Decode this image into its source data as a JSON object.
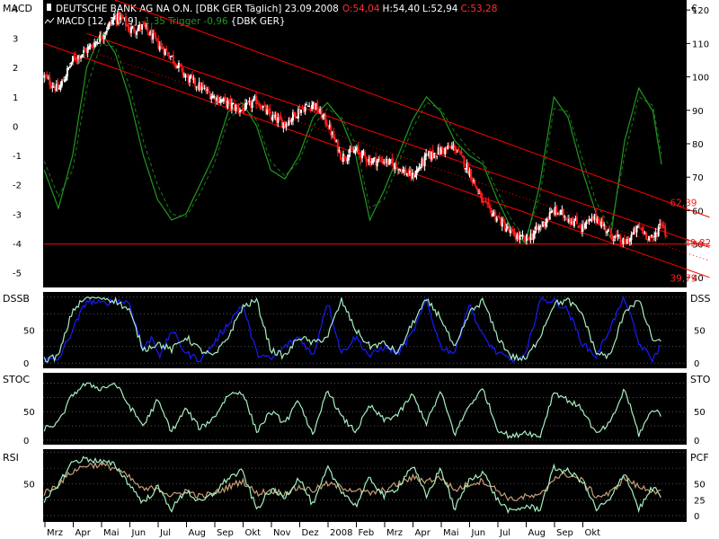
{
  "chart_data": [
    {
      "type": "line",
      "panel": "MACD",
      "title": "DEUTSCHE BANK AG NA O.N. [DBK GER  Täglich] 23.09.2008",
      "ohlc": {
        "open_label": "O:54,04",
        "high_label": "H:54,40",
        "low_label": "L:52,94",
        "close_label": "C:53,28"
      },
      "subtitle": "MACD [12, 26, 9]",
      "macd_value_label": "-1,35",
      "trigger_label": "Trigger -0,96",
      "subtitle_suffix": "{DBK GER}",
      "left_label": "MACD",
      "right_label": "€",
      "left_ticks": [
        "4",
        "3",
        "2",
        "1",
        "0",
        "-1",
        "-2",
        "-3",
        "-4",
        "-5"
      ],
      "right_ticks": [
        "120",
        "110",
        "100",
        "90",
        "80",
        "70",
        "60",
        "50",
        "40"
      ],
      "ylim_left": [
        -5.5,
        4.3
      ],
      "ylim_right": [
        37,
        123
      ],
      "x_month_positions": [
        0,
        1,
        2,
        3,
        4,
        5,
        6,
        7,
        8,
        9,
        10,
        11,
        12,
        13,
        14,
        15,
        16,
        17,
        18,
        19,
        20,
        21,
        22
      ],
      "price_knots": {
        "x": [
          -0.5,
          0,
          0.5,
          1,
          1.5,
          2,
          2.3,
          2.5,
          3,
          3.5,
          4,
          4.5,
          5,
          5.5,
          6,
          6.5,
          7,
          7.5,
          8,
          8.5,
          9,
          9.5,
          10,
          10.5,
          11,
          11.5,
          12,
          12.5,
          13,
          13.5,
          14,
          14.5,
          15,
          15.5,
          16,
          16.5,
          17,
          17.5,
          18,
          18.5,
          19,
          19.5,
          20,
          20.5,
          21,
          21.3,
          21.5
        ],
        "y": [
          100,
          96,
          105,
          108,
          112,
          118,
          117,
          114,
          115,
          110,
          106,
          100,
          97,
          94,
          92,
          90,
          93,
          88,
          86,
          90,
          92,
          86,
          76,
          78,
          75,
          75,
          73,
          70,
          76,
          78,
          79,
          72,
          62,
          58,
          53,
          51,
          55,
          60,
          58,
          55,
          58,
          53,
          50,
          55,
          51,
          57,
          52
        ]
      },
      "macd_knots": {
        "x": [
          -0.5,
          0,
          0.5,
          1,
          1.5,
          2,
          2.5,
          3,
          3.5,
          4,
          4.5,
          5,
          5.5,
          6,
          6.5,
          7,
          7.5,
          8,
          8.5,
          9,
          9.5,
          10,
          10.5,
          11,
          11.5,
          12,
          12.5,
          13,
          13.5,
          14,
          14.5,
          15,
          15.5,
          16,
          16.5,
          17,
          17.5,
          18,
          18.5,
          19,
          19.5,
          20,
          20.5,
          21,
          21.3
        ],
        "y": [
          -1.5,
          -2.8,
          -1,
          2,
          3.2,
          2.5,
          1,
          -1,
          -2.5,
          -3.2,
          -3,
          -2,
          -1,
          0.5,
          0.8,
          0,
          -1.5,
          -1.8,
          -1,
          0.3,
          0.8,
          0.2,
          -1,
          -3.2,
          -2.2,
          -1,
          0.2,
          1,
          0.5,
          -0.5,
          -1,
          -1.3,
          -2.5,
          -3.5,
          -4,
          -2,
          1,
          0.3,
          -1.5,
          -3,
          -3.8,
          -0.5,
          1.3,
          0.5,
          -1.3
        ]
      },
      "trigger_knots": {
        "x": [
          -0.5,
          0,
          0.5,
          1,
          1.5,
          2,
          2.5,
          3,
          3.5,
          4,
          4.5,
          5,
          5.5,
          6,
          6.5,
          7,
          7.5,
          8,
          8.5,
          9,
          9.5,
          10,
          10.5,
          11,
          11.5,
          12,
          12.5,
          13,
          13.5,
          14,
          14.5,
          15,
          15.5,
          16,
          16.5,
          17,
          17.5,
          18,
          18.5,
          19,
          19.5,
          20,
          20.5,
          21,
          21.3
        ],
        "y": [
          -1.2,
          -2.4,
          -1.5,
          1.3,
          2.8,
          2.7,
          1.4,
          -0.5,
          -2,
          -3,
          -3.1,
          -2.3,
          -1.3,
          0.2,
          0.7,
          0.2,
          -1.2,
          -1.7,
          -1.2,
          0,
          0.6,
          0.3,
          -0.6,
          -2.8,
          -2.5,
          -1.3,
          -0.1,
          0.8,
          0.6,
          -0.2,
          -0.8,
          -1.2,
          -2.2,
          -3.2,
          -3.8,
          -2.4,
          0.6,
          0.5,
          -1.1,
          -2.6,
          -3.5,
          -1,
          1,
          0.7,
          -0.96
        ]
      },
      "trendlines": [
        {
          "from": [
            2,
            123
          ],
          "to": [
            23,
            58
          ]
        },
        {
          "from": [
            -0.5,
            110
          ],
          "to": [
            23,
            40
          ]
        },
        {
          "from": [
            1,
            113
          ],
          "to": [
            23,
            49
          ]
        },
        {
          "from": [
            -0.5,
            50
          ],
          "to": [
            23,
            50
          ]
        }
      ],
      "annotations": [
        {
          "text": "62,39",
          "x": 21.6,
          "y": 62.4
        },
        {
          "text": "49,82",
          "x": 22.1,
          "y": 50.5
        },
        {
          "text": "39,79",
          "x": 21.6,
          "y": 39.8
        }
      ],
      "colors": {
        "up": "#ffffff",
        "down": "#ff1a1a",
        "macd": "#1f9a1f",
        "trigger": "#1a7a1a",
        "trend": "#ff0000"
      }
    },
    {
      "type": "line",
      "panel": "DSSB",
      "left_label": "DSSB",
      "right_label": "DSS",
      "left_ticks": [
        "50",
        "0"
      ],
      "right_ticks": [
        "50",
        "0"
      ],
      "ylim": [
        -8,
        108
      ],
      "series": [
        {
          "color": "#1a1aff",
          "x": [
            -0.5,
            0,
            0.5,
            1,
            1.5,
            2,
            2.5,
            3,
            3.3,
            3.6,
            4,
            4.5,
            5,
            5.5,
            6,
            6.5,
            7,
            7.5,
            8,
            8.5,
            9,
            9.5,
            10,
            10.5,
            11,
            11.5,
            12,
            12.5,
            13,
            13.5,
            14,
            14.5,
            15,
            15.5,
            16,
            16.5,
            17,
            17.5,
            18,
            18.5,
            19,
            19.5,
            20,
            20.5,
            21,
            21.3
          ],
          "y": [
            5,
            5,
            50,
            95,
            90,
            95,
            92,
            20,
            40,
            10,
            50,
            15,
            5,
            30,
            60,
            90,
            15,
            5,
            25,
            40,
            10,
            95,
            15,
            40,
            10,
            25,
            15,
            45,
            95,
            25,
            15,
            90,
            40,
            15,
            5,
            10,
            95,
            95,
            80,
            30,
            10,
            55,
            100,
            30,
            5,
            30
          ]
        },
        {
          "color": "#a6f0c0",
          "x": [
            -0.5,
            0,
            0.5,
            1,
            1.5,
            2,
            2.5,
            3,
            3.5,
            4,
            4.5,
            5,
            5.5,
            6,
            6.5,
            7,
            7.5,
            8,
            8.5,
            9,
            9.5,
            10,
            10.5,
            11,
            11.5,
            12,
            12.5,
            13,
            13.5,
            14,
            14.5,
            15,
            15.5,
            16,
            16.5,
            17,
            17.5,
            18,
            18.5,
            19,
            19.5,
            20,
            20.5,
            21,
            21.3
          ],
          "y": [
            5,
            10,
            80,
            100,
            100,
            95,
            80,
            20,
            30,
            20,
            40,
            20,
            10,
            40,
            85,
            95,
            20,
            10,
            40,
            30,
            40,
            95,
            50,
            25,
            30,
            15,
            60,
            95,
            70,
            20,
            75,
            95,
            40,
            10,
            5,
            40,
            90,
            95,
            75,
            15,
            10,
            80,
            95,
            35,
            30
          ]
        }
      ]
    },
    {
      "type": "line",
      "panel": "STOC",
      "left_label": "STOC",
      "right_label": "STO",
      "left_ticks": [
        "50",
        "0"
      ],
      "right_ticks": [
        "50",
        "0"
      ],
      "ylim": [
        -8,
        118
      ],
      "series": [
        {
          "color": "#a6f0c0",
          "x": [
            -0.5,
            0,
            0.5,
            1,
            1.5,
            2,
            2.5,
            3,
            3.5,
            4,
            4.5,
            5,
            5.5,
            6,
            6.5,
            7,
            7.5,
            8,
            8.5,
            9,
            9.5,
            10,
            10.5,
            11,
            11.5,
            12,
            12.5,
            13,
            13.5,
            14,
            14.5,
            15,
            15.5,
            16,
            16.5,
            17,
            17.5,
            18,
            18.5,
            19,
            19.5,
            20,
            20.5,
            21,
            21.3
          ],
          "y": [
            20,
            30,
            80,
            100,
            90,
            100,
            60,
            25,
            70,
            15,
            55,
            20,
            40,
            80,
            85,
            15,
            50,
            30,
            70,
            5,
            90,
            40,
            15,
            60,
            35,
            45,
            80,
            30,
            85,
            10,
            60,
            90,
            20,
            5,
            15,
            5,
            85,
            70,
            55,
            10,
            30,
            90,
            10,
            55,
            45
          ]
        }
      ]
    },
    {
      "type": "line",
      "panel": "RSI",
      "left_label": "RSI",
      "right_label": "PCF",
      "left_ticks": [
        "50"
      ],
      "right_ticks": [
        "50",
        "25",
        "0"
      ],
      "ylim": [
        -10,
        105
      ],
      "series": [
        {
          "color": "#c8a078",
          "x": [
            -0.5,
            0,
            0.5,
            1,
            1.5,
            2,
            2.5,
            3,
            3.5,
            4,
            4.5,
            5,
            5.5,
            6,
            6.5,
            7,
            7.5,
            8,
            8.5,
            9,
            9.5,
            10,
            10.5,
            11,
            11.5,
            12,
            12.5,
            13,
            13.5,
            14,
            14.5,
            15,
            15.5,
            16,
            16.5,
            17,
            17.5,
            18,
            18.5,
            19,
            19.5,
            20,
            20.5,
            21,
            21.3
          ],
          "y": [
            35,
            50,
            70,
            80,
            80,
            75,
            60,
            40,
            45,
            30,
            40,
            30,
            35,
            45,
            55,
            35,
            40,
            35,
            45,
            40,
            50,
            45,
            40,
            35,
            40,
            50,
            60,
            55,
            60,
            40,
            50,
            55,
            40,
            25,
            30,
            30,
            60,
            65,
            55,
            30,
            35,
            60,
            45,
            40,
            35
          ]
        },
        {
          "color": "#a6f0c0",
          "x": [
            -0.5,
            0,
            0.5,
            1,
            1.5,
            2,
            2.5,
            3,
            3.5,
            4,
            4.5,
            5,
            5.5,
            6,
            6.5,
            7,
            7.5,
            8,
            8.5,
            9,
            9.5,
            10,
            10.5,
            11,
            11.5,
            12,
            12.5,
            13,
            13.5,
            14,
            14.5,
            15,
            15.5,
            16,
            16.5,
            17,
            17.5,
            18,
            18.5,
            19,
            19.5,
            20,
            20.5,
            21,
            21.3
          ],
          "y": [
            20,
            50,
            85,
            90,
            85,
            80,
            50,
            20,
            45,
            10,
            40,
            20,
            35,
            60,
            70,
            10,
            40,
            30,
            60,
            15,
            75,
            40,
            15,
            60,
            30,
            45,
            80,
            30,
            75,
            10,
            55,
            70,
            25,
            5,
            15,
            10,
            75,
            70,
            55,
            10,
            25,
            70,
            10,
            45,
            30
          ]
        }
      ]
    }
  ],
  "x_axis": {
    "labels": [
      "Mrz",
      "Apr",
      "Mai",
      "Jun",
      "Jul",
      "Aug",
      "Sep",
      "Okt",
      "Nov",
      "Dez",
      "2008",
      "Feb",
      "Mrz",
      "Apr",
      "Mai",
      "Jun",
      "Jul",
      "Aug",
      "Sep",
      "Okt"
    ]
  }
}
